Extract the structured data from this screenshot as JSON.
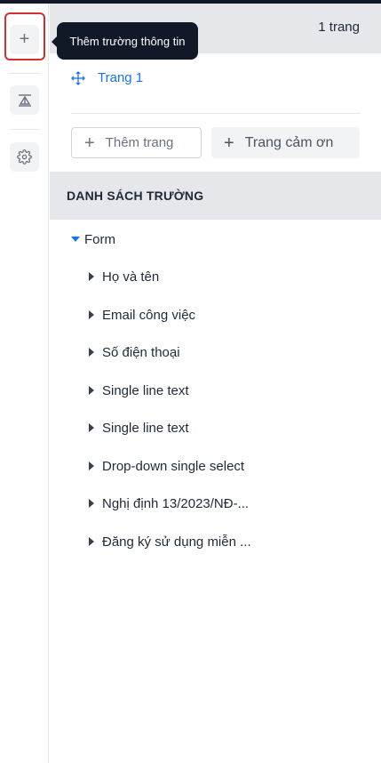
{
  "rail": {
    "add_icon": "plus-icon",
    "layout_icon": "layout-icon",
    "settings_icon": "gear-icon"
  },
  "tooltip": {
    "text": "Thêm trường thông tin"
  },
  "pages": {
    "count_label": "1 trang",
    "items": [
      {
        "label": "Trang 1",
        "icon": "move-icon"
      }
    ],
    "add_page_label": "Thêm trang",
    "thanks_page_label": "Trang cảm ơn"
  },
  "fields_list": {
    "header": "DANH SÁCH TRƯỜNG",
    "root_label": "Form",
    "fields": [
      "Họ và tên",
      "Email công việc",
      "Số điện thoại",
      "Single line text",
      "Single line text",
      "Drop-down single select",
      "Nghị định 13/2023/NĐ-...",
      "Đăng ký sử dụng miễn ..."
    ]
  },
  "colors": {
    "accent": "#1a73e8",
    "highlight": "#d32f2f",
    "tooltip_bg": "#111827"
  }
}
